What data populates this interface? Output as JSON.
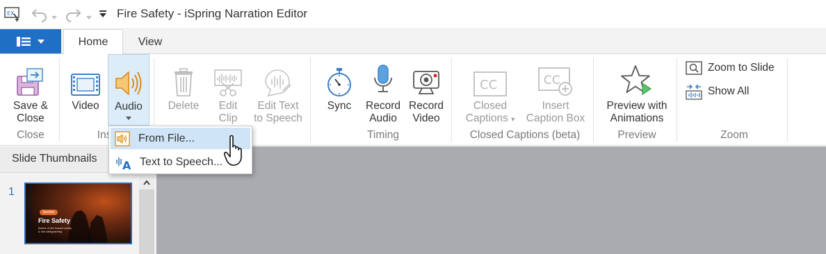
{
  "window": {
    "title": "Fire Safety - iSpring Narration Editor"
  },
  "tabs": [
    {
      "label": "Home",
      "active": true
    },
    {
      "label": "View",
      "active": false
    }
  ],
  "ribbon": {
    "save_close": {
      "line1": "Save &",
      "line2": "Close"
    },
    "video": "Video",
    "audio": "Audio",
    "delete": "Delete",
    "edit_clip": {
      "line1": "Edit",
      "line2": "Clip"
    },
    "edit_text_speech": {
      "line1": "Edit Text",
      "line2": "to Speech"
    },
    "sync": "Sync",
    "record_audio": {
      "line1": "Record",
      "line2": "Audio"
    },
    "record_video": {
      "line1": "Record",
      "line2": "Video"
    },
    "closed_captions": {
      "line1": "Closed",
      "line2": "Captions"
    },
    "insert_caption_box": {
      "line1": "Insert",
      "line2": "Caption Box"
    },
    "preview_animations": {
      "line1": "Preview with",
      "line2": "Animations"
    },
    "zoom_to_slide": "Zoom to Slide",
    "show_all": "Show All",
    "groups": {
      "close": "Close",
      "insert": "Ins",
      "timing": "Timing",
      "closed_captions": "Closed Captions (beta)",
      "preview": "Preview",
      "zoom": "Zoom"
    }
  },
  "audio_menu": {
    "items": [
      {
        "label": "From File..."
      },
      {
        "label": "Text to Speech..."
      }
    ]
  },
  "slide_panel": {
    "title": "Slide Thumbnails",
    "slides": [
      {
        "number": "1",
        "badge": "Section",
        "title": "Fire Safety",
        "subtitle_line1": "Basics of fire hazard safety",
        "subtitle_line2": "& risk safeguarding"
      }
    ]
  },
  "colors": {
    "accent": "#1f6fc5",
    "workspace": "#a9abaf",
    "hover": "#cfe4f6"
  }
}
